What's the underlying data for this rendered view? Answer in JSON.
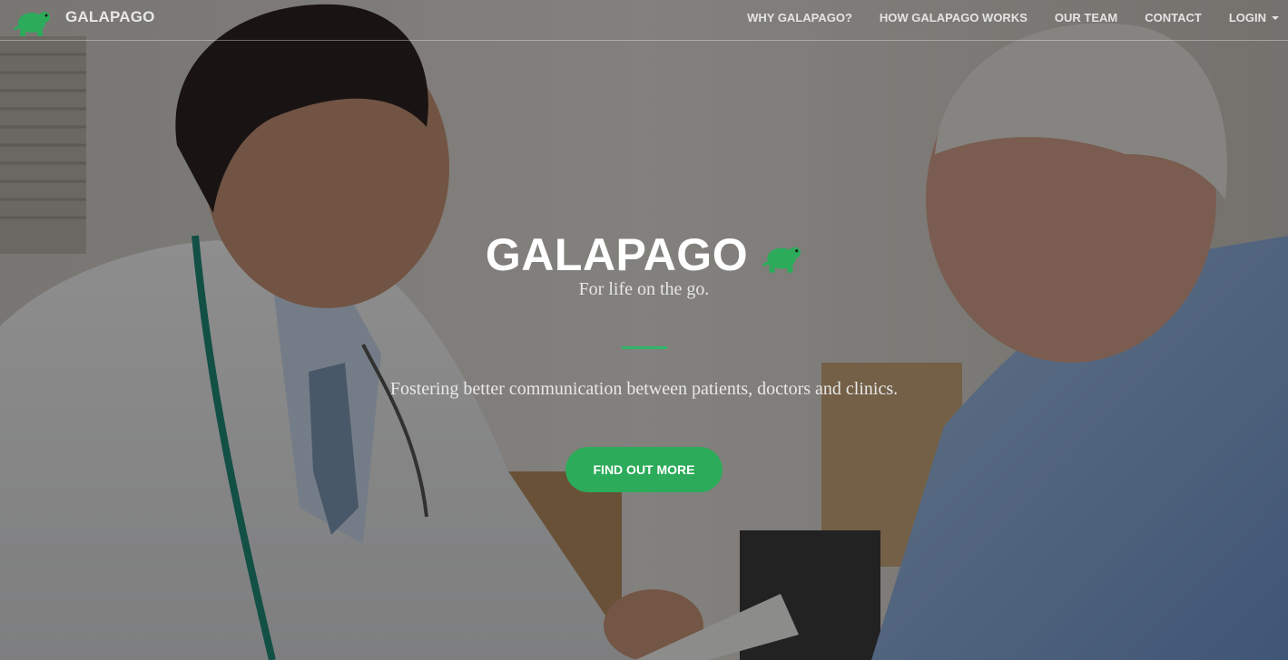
{
  "brand": {
    "name": "GALAPAGO",
    "logo_icon": "turtle-icon",
    "accent_color": "#2cab5a"
  },
  "nav": {
    "items": [
      {
        "label": "WHY GALAPAGO?"
      },
      {
        "label": "HOW GALAPAGO WORKS"
      },
      {
        "label": "OUR TEAM"
      },
      {
        "label": "CONTACT"
      },
      {
        "label": "LOGIN"
      }
    ]
  },
  "hero": {
    "title": "GALAPAGO",
    "title_icon": "turtle-icon",
    "tagline": "For life on the go.",
    "lead": "Fostering better communication between patients, doctors and clinics.",
    "cta_label": "FIND OUT MORE"
  }
}
